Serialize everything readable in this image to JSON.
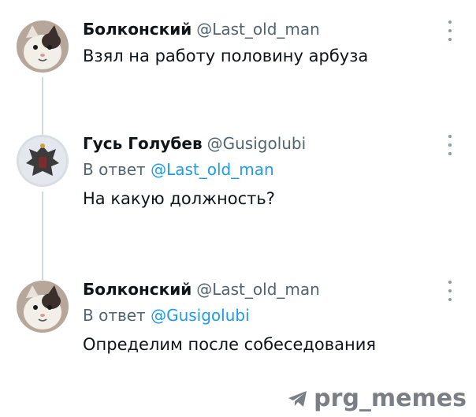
{
  "tweets": [
    {
      "author": "Болконский",
      "handle": "@Last_old_man",
      "reply_prefix": "",
      "reply_to": "",
      "text": "Взял на работу половину арбуза",
      "avatar_icon": "cat-avatar"
    },
    {
      "author": "Гусь Голубев",
      "handle": "@Gusigolubi",
      "reply_prefix": "В ответ ",
      "reply_to": "@Last_old_man",
      "text": "На какую должность?",
      "avatar_icon": "coat-of-arms-avatar"
    },
    {
      "author": "Болконский",
      "handle": "@Last_old_man",
      "reply_prefix": "В ответ ",
      "reply_to": "@Gusigolubi",
      "text": "Определим после собеседования",
      "avatar_icon": "cat-avatar"
    }
  ],
  "watermark": {
    "text": "prg_memes",
    "icon": "telegram-icon"
  },
  "colors": {
    "handle": "#536471",
    "mention": "#1d9bf0",
    "thread_line": "#cfd9de"
  }
}
